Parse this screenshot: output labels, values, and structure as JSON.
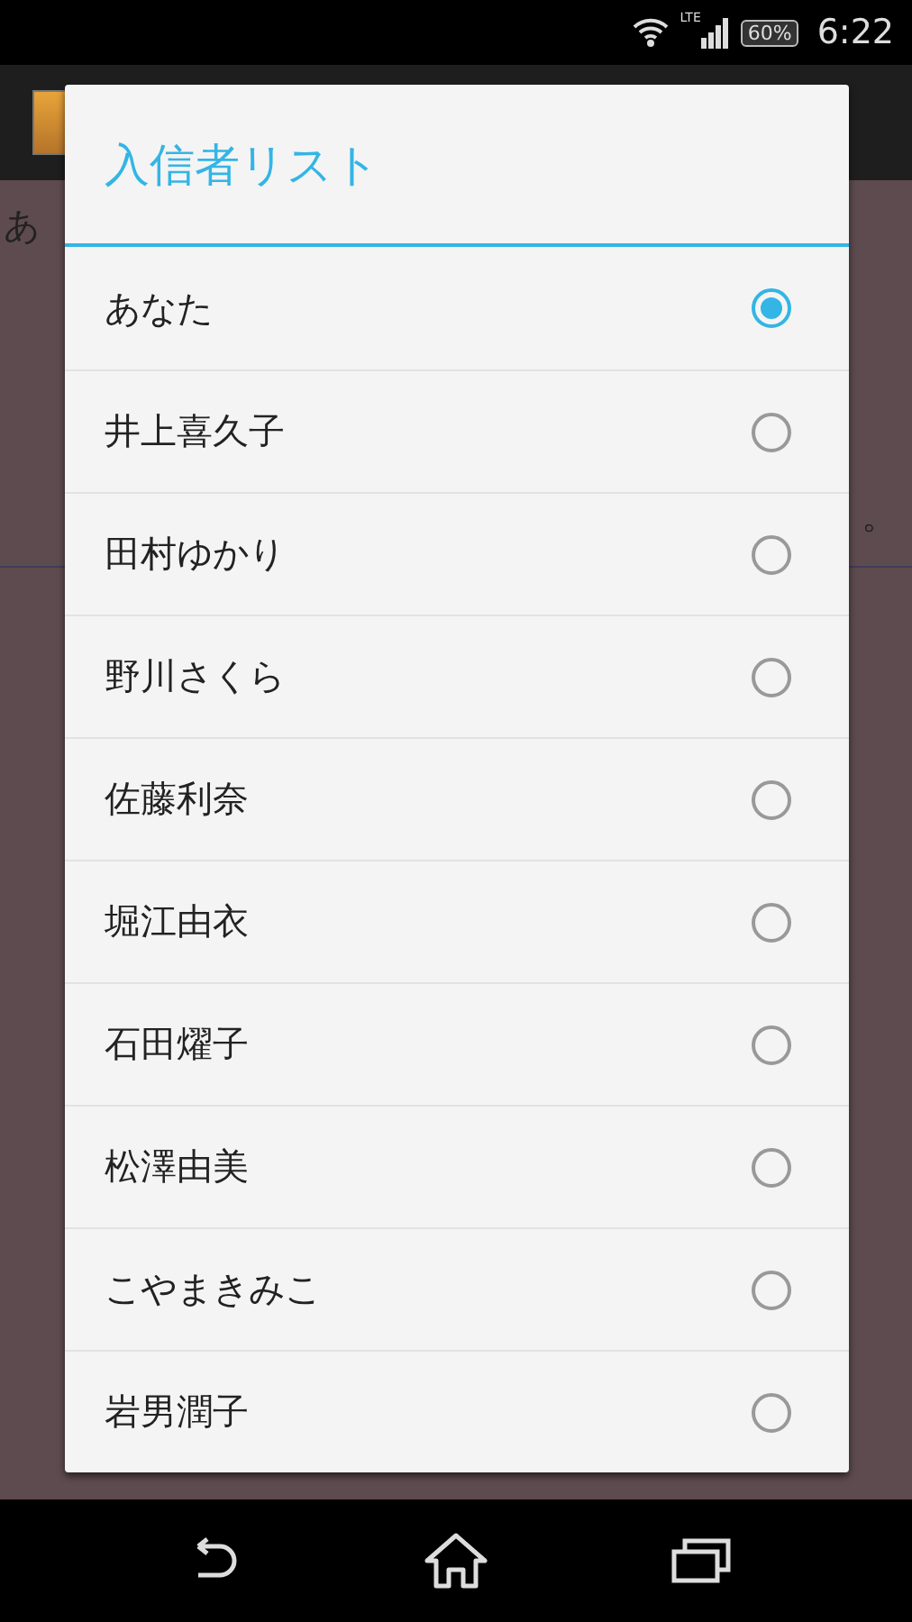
{
  "status_bar": {
    "network": "LTE",
    "battery": "60%",
    "time": "6:22"
  },
  "background": {
    "text_1": "あ",
    "text_2": "。"
  },
  "dialog": {
    "title": "入信者リスト",
    "items": [
      {
        "label": "あなた",
        "selected": true
      },
      {
        "label": "井上喜久子",
        "selected": false
      },
      {
        "label": "田村ゆかり",
        "selected": false
      },
      {
        "label": "野川さくら",
        "selected": false
      },
      {
        "label": "佐藤利奈",
        "selected": false
      },
      {
        "label": "堀江由衣",
        "selected": false
      },
      {
        "label": "石田燿子",
        "selected": false
      },
      {
        "label": "松澤由美",
        "selected": false
      },
      {
        "label": "こやまきみこ",
        "selected": false
      },
      {
        "label": "岩男潤子",
        "selected": false
      }
    ]
  }
}
